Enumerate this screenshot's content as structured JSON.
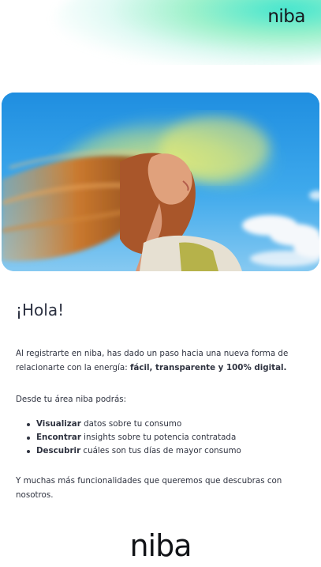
{
  "header": {
    "logo_text": "niba",
    "accent_colors": [
      "#00dcbe",
      "#50e6a0",
      "#aaf0e1"
    ]
  },
  "hero": {
    "image_description_icon": "hero-photo-woman-hair-wind"
  },
  "content": {
    "greeting": "¡Hola!",
    "intro_text": "Al registrarte en niba, has dado un paso hacia una nueva forma de relacionarte con la energía: ",
    "intro_bold": "fácil, transparente y 100% digital.",
    "area_intro": "Desde tu área niba podrás:",
    "features": [
      {
        "bold": "Visualizar",
        "text": " datos sobre tu consumo"
      },
      {
        "bold": "Encontrar",
        "text": " insights sobre tu potencia contratada"
      },
      {
        "bold": "Descubrir",
        "text": " cuáles son tus días de mayor consumo"
      }
    ],
    "closing": "Y muchas más funcionalidades que queremos que descubras con nosotros."
  },
  "footer": {
    "logo_text": "niba"
  }
}
